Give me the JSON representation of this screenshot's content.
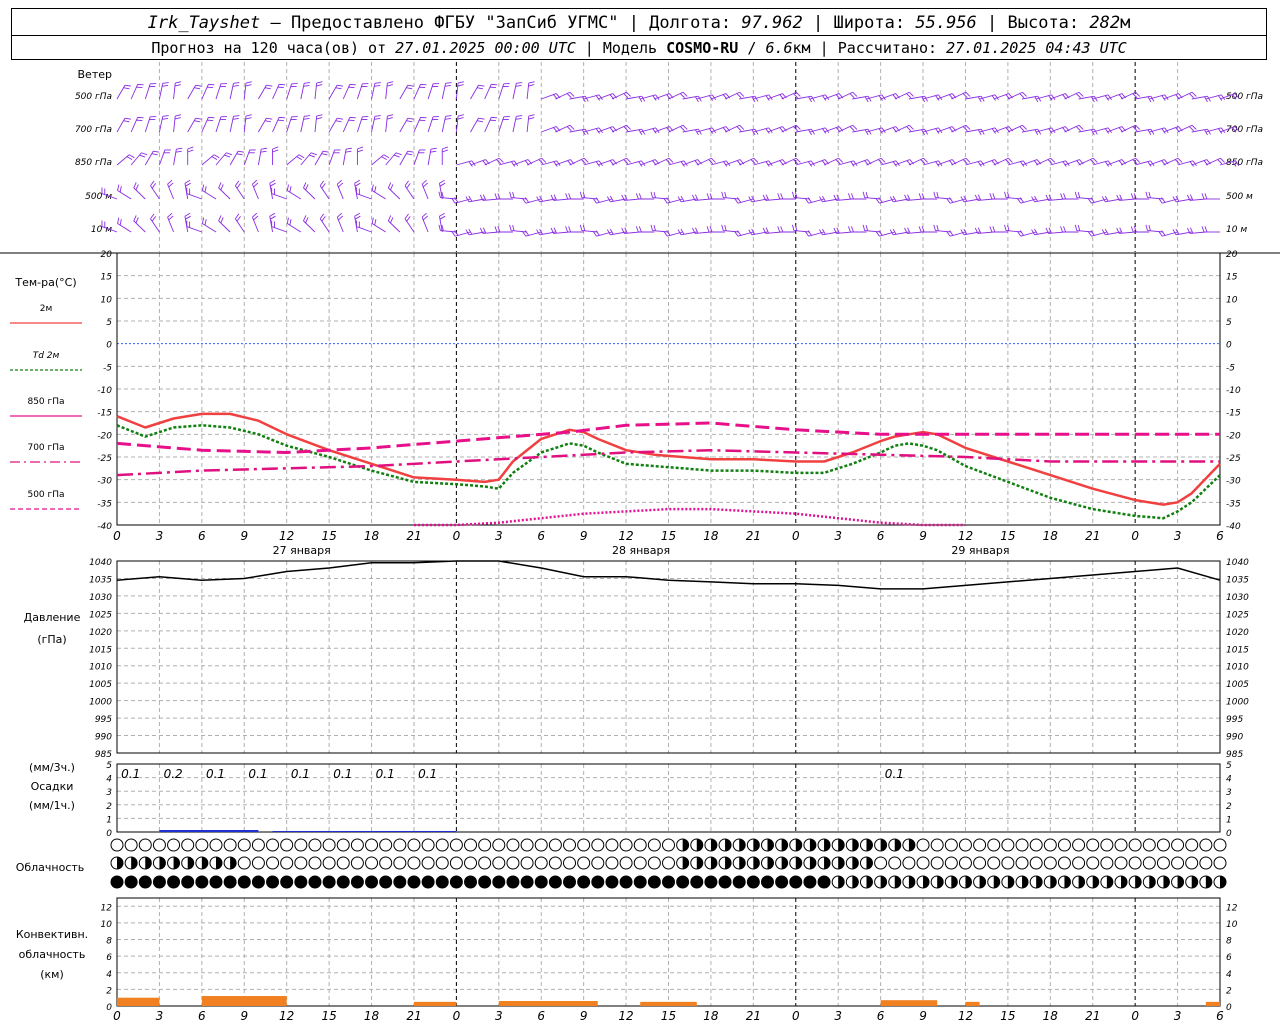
{
  "header": {
    "station": "Irk_Tayshet",
    "provider": "Предоставлено ФГБУ \"ЗапСиб УГМС\"",
    "lon_label": "Долгота:",
    "lon": "97.962",
    "lat_label": "Широта:",
    "lat": "55.956",
    "alt_label": "Высота:",
    "alt": "282",
    "alt_unit": "м",
    "forecast_prefix": "Прогноз на 120 часа(ов) от",
    "forecast_start": "27.01.2025 00:00 UTC",
    "model_label": "Модель",
    "model": "COSMO-RU",
    "resolution": "6.6",
    "resolution_unit": "км",
    "calc_label": "Рассчитано:",
    "calc_time": "27.01.2025 04:43 UTC"
  },
  "colors": {
    "t2m": "#f04040",
    "td2m": "#108010",
    "t850": "#e8108a",
    "t700": "#e01080",
    "t500": "#e01090",
    "zero": "#3060ff",
    "pressure": "#000000",
    "precip": "#2030d0",
    "convective": "#f08020",
    "wind": "#8a2be2"
  },
  "wind_panel": {
    "title": "Ветер",
    "levels": [
      "500 гПа",
      "700 гПа",
      "850 гПа",
      "500 м",
      "10 м"
    ]
  },
  "temp_panel": {
    "title": "Тем-ра(°C)",
    "legend": [
      "2м",
      "Td 2м",
      "850 гПа",
      "700 гПа",
      "500 гПа"
    ]
  },
  "pressure_panel": {
    "title1": "Давление",
    "title2": "(гПа)"
  },
  "precip_panel": {
    "title1": "(мм/3ч.)",
    "title2": "Осадки",
    "title3": "(мм/1ч.)"
  },
  "cloud_panel": {
    "title": "Облачность"
  },
  "conv_panel": {
    "title1": "Конвективн.",
    "title2": "облачность",
    "title3": "(км)"
  },
  "axis": {
    "hour_labels": [
      "0",
      "3",
      "6",
      "9",
      "12",
      "15",
      "18",
      "21",
      "0",
      "3",
      "6",
      "9",
      "12",
      "15",
      "18",
      "21",
      "0",
      "3",
      "6",
      "9",
      "12",
      "15",
      "18",
      "21",
      "0",
      "3",
      "6"
    ],
    "date_labels": [
      "27 января",
      "28 января",
      "29 января"
    ]
  },
  "chart_data": {
    "type": "line",
    "x_unit": "hours since 27.01.2025 00:00 UTC",
    "x_range": [
      0,
      78
    ],
    "temperature": {
      "ylim": [
        -40,
        20
      ],
      "ticks": [
        20,
        15,
        10,
        5,
        0,
        -5,
        -10,
        -15,
        -20,
        -25,
        -30,
        -35,
        -40
      ],
      "series": [
        {
          "name": "2м",
          "x": [
            0,
            2,
            3,
            4,
            6,
            8,
            10,
            12,
            15,
            18,
            21,
            24,
            26,
            27,
            28,
            30,
            32,
            33,
            34,
            36,
            38,
            40,
            42,
            45,
            48,
            50,
            51,
            52,
            54,
            55,
            56,
            57,
            58,
            60,
            63,
            66,
            69,
            72,
            74,
            75,
            76,
            78
          ],
          "y": [
            -16,
            -18.5,
            -17.5,
            -16.5,
            -15.5,
            -15.5,
            -17,
            -20,
            -23.5,
            -26.5,
            -29.5,
            -30,
            -30.5,
            -30,
            -26,
            -21,
            -19,
            -19.5,
            -21,
            -23.5,
            -24.5,
            -25,
            -25.5,
            -25.5,
            -26,
            -26,
            -25,
            -24,
            -21.5,
            -20.5,
            -20,
            -19.5,
            -20,
            -23,
            -26,
            -29,
            -32,
            -34.5,
            -35.5,
            -35,
            -33,
            -26.5
          ]
        },
        {
          "name": "Td 2м",
          "x": [
            0,
            2,
            3,
            4,
            6,
            8,
            10,
            12,
            15,
            18,
            21,
            24,
            26,
            27,
            28,
            30,
            32,
            33,
            34,
            36,
            38,
            40,
            42,
            45,
            48,
            50,
            51,
            52,
            54,
            55,
            56,
            57,
            58,
            60,
            63,
            66,
            69,
            72,
            74,
            75,
            76,
            78
          ],
          "y": [
            -18,
            -20.5,
            -19.5,
            -18.5,
            -18,
            -18.5,
            -20,
            -22.5,
            -25,
            -28,
            -30.5,
            -31,
            -31.5,
            -32,
            -28.5,
            -24,
            -22,
            -22.5,
            -24,
            -26.5,
            -27,
            -27.5,
            -28,
            -28,
            -28.5,
            -28.5,
            -27.5,
            -26.5,
            -24,
            -22.5,
            -22,
            -22.5,
            -23.5,
            -27,
            -30.5,
            -34,
            -36.5,
            -38,
            -38.5,
            -37,
            -35,
            -29
          ]
        },
        {
          "name": "850 гПа",
          "x": [
            0,
            6,
            12,
            18,
            24,
            28,
            32,
            36,
            42,
            48,
            54,
            60,
            66,
            72,
            78
          ],
          "y": [
            -22,
            -23.5,
            -24,
            -23,
            -21.5,
            -20.5,
            -19.5,
            -18,
            -17.5,
            -19,
            -20,
            -20,
            -20,
            -20,
            -20
          ]
        },
        {
          "name": "700 гПа",
          "x": [
            0,
            6,
            12,
            18,
            24,
            30,
            36,
            42,
            48,
            54,
            60,
            66,
            72,
            78
          ],
          "y": [
            -29,
            -28,
            -27.5,
            -27,
            -26,
            -25,
            -24,
            -23.5,
            -24,
            -24.5,
            -25,
            -26,
            -26,
            -26
          ]
        },
        {
          "name": "500 гПа",
          "x": [
            21,
            24,
            27,
            30,
            33,
            36,
            39,
            42,
            45,
            48,
            51,
            54,
            57,
            60
          ],
          "y": [
            -40,
            -40,
            -39.5,
            -38.5,
            -37.5,
            -37,
            -36.5,
            -36.5,
            -37,
            -37.5,
            -38.5,
            -39.5,
            -40,
            -40
          ]
        }
      ]
    },
    "pressure": {
      "ylim": [
        985,
        1040
      ],
      "ticks": [
        1040,
        1035,
        1030,
        1025,
        1020,
        1015,
        1010,
        1005,
        1000,
        995,
        990,
        985
      ],
      "x": [
        0,
        3,
        6,
        9,
        12,
        15,
        18,
        21,
        24,
        27,
        30,
        33,
        36,
        39,
        42,
        45,
        48,
        51,
        54,
        57,
        60,
        63,
        66,
        69,
        72,
        75,
        78
      ],
      "y": [
        1034.5,
        1035.5,
        1034.5,
        1035,
        1037,
        1038,
        1039.5,
        1039.5,
        1040,
        1040,
        1038,
        1035.5,
        1035.5,
        1034.5,
        1034,
        1033.5,
        1033.5,
        1033,
        1032,
        1032,
        1033,
        1034,
        1035,
        1036,
        1037,
        1038,
        1034.5
      ]
    },
    "precipitation": {
      "ylim": [
        0,
        5
      ],
      "ticks": [
        5,
        4,
        3,
        2,
        1,
        0
      ],
      "labels_x": [
        1,
        4,
        7,
        10,
        13,
        16,
        19,
        22,
        55
      ],
      "labels": [
        "0.1",
        "0.2",
        "0.1",
        "0.1",
        "0.1",
        "0.1",
        "0.1",
        "0.1",
        "0.1"
      ]
    },
    "convective": {
      "ylim": [
        0,
        13
      ],
      "ticks": [
        12,
        10,
        8,
        6,
        4,
        2,
        0
      ],
      "segments": [
        [
          0,
          3,
          1
        ],
        [
          6,
          12,
          1.2
        ],
        [
          21,
          24,
          0.5
        ],
        [
          27,
          34,
          0.6
        ],
        [
          37,
          41,
          0.5
        ],
        [
          54,
          58,
          0.7
        ],
        [
          60,
          61,
          0.5
        ],
        [
          77,
          78,
          0.5
        ]
      ]
    }
  }
}
